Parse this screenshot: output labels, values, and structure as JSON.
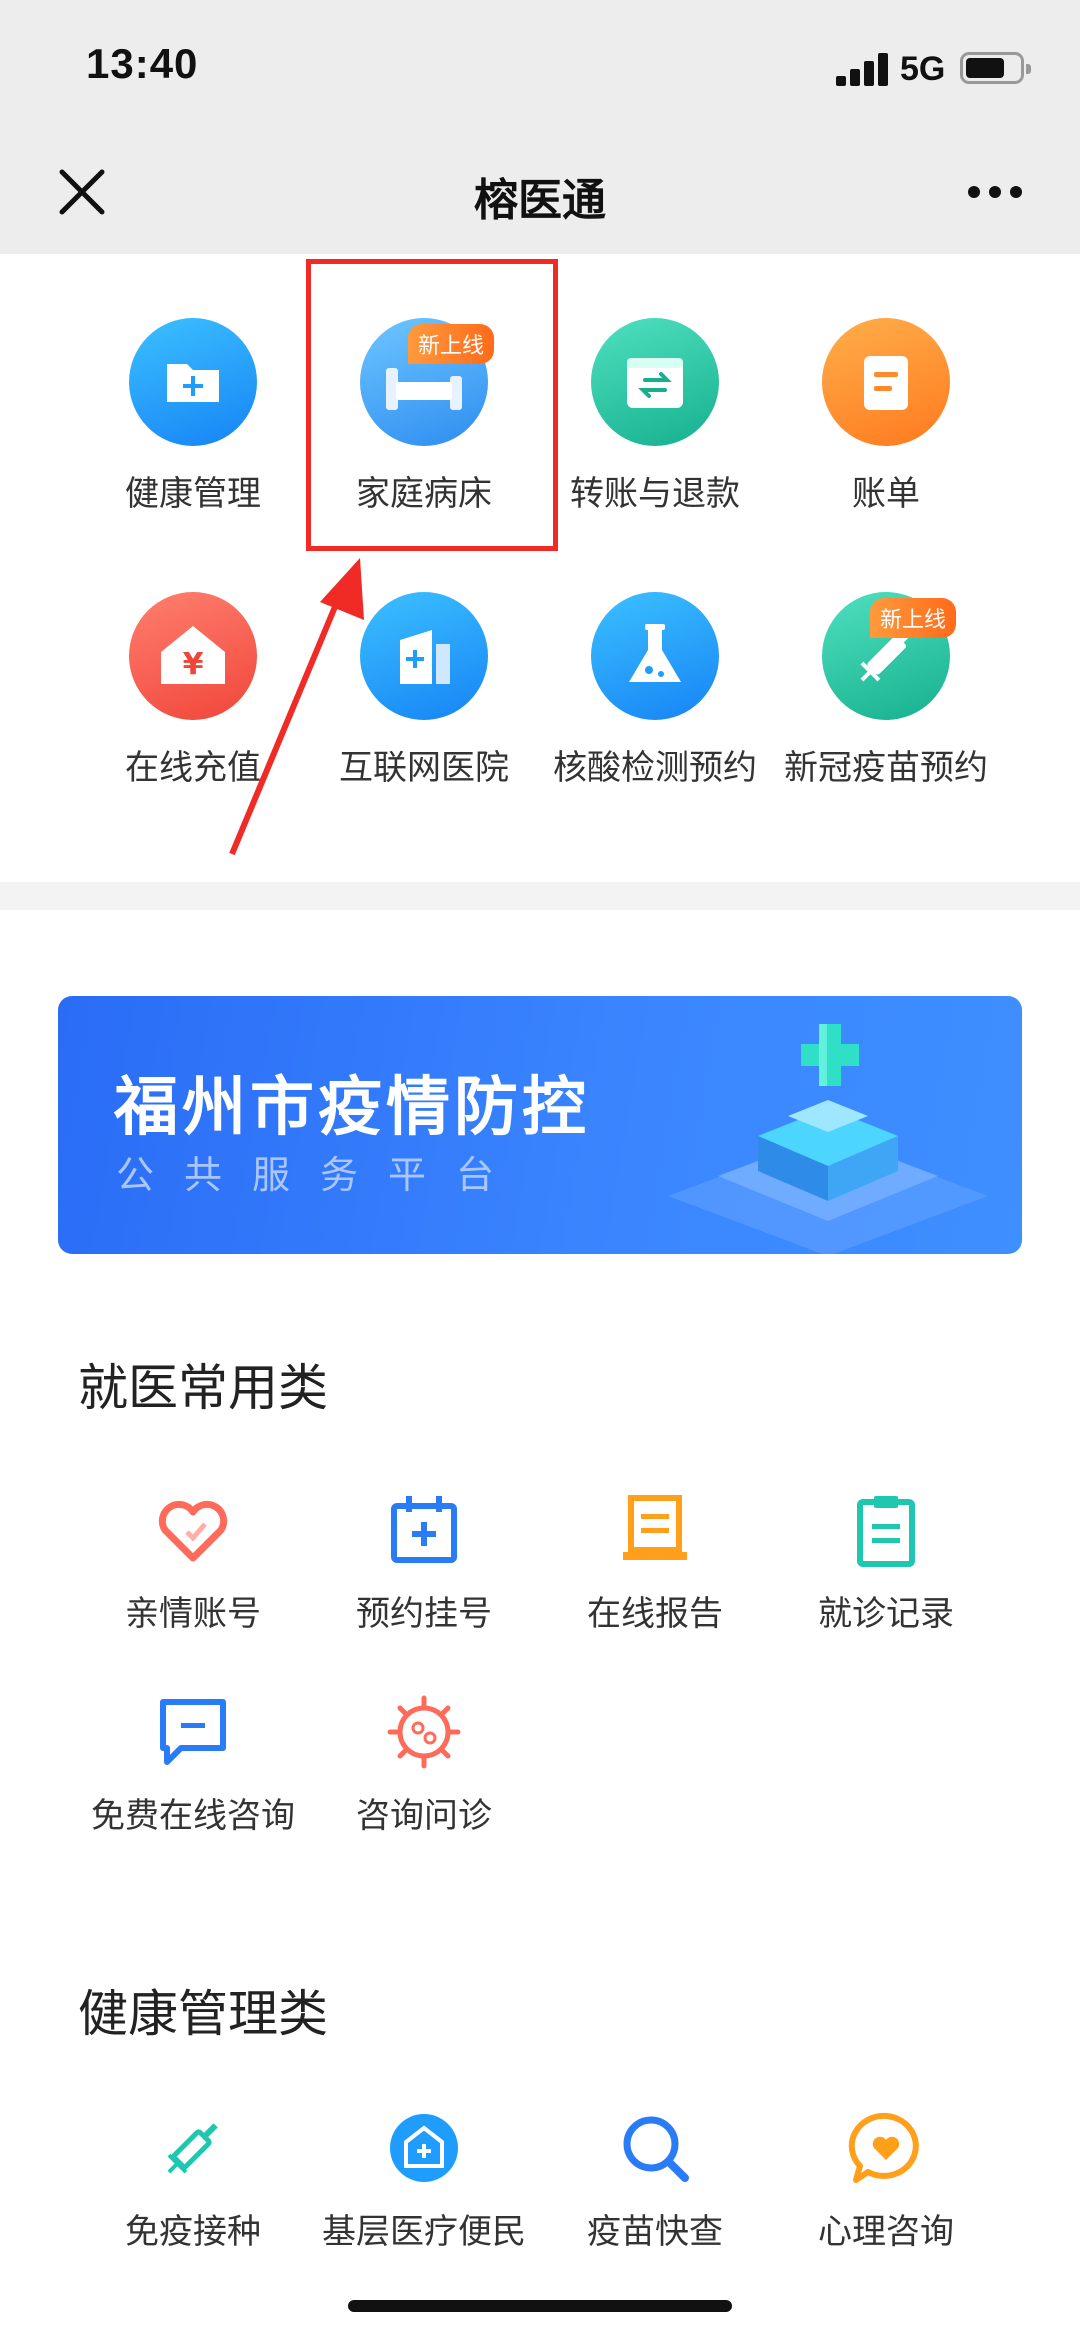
{
  "status_bar": {
    "time": "13:40",
    "network": "5G"
  },
  "title_bar": {
    "title": "榕医通"
  },
  "top_services": [
    {
      "label": "健康管理",
      "icon": "folder-plus-icon",
      "color": "#1e9dff"
    },
    {
      "label": "家庭病床",
      "icon": "bed-icon",
      "color": "#3aa6ff",
      "badge": "新上线"
    },
    {
      "label": "转账与退款",
      "icon": "transfer-icon",
      "color": "#22c4a2"
    },
    {
      "label": "账单",
      "icon": "bill-icon",
      "color": "#ff8a2c"
    },
    {
      "label": "在线充值",
      "icon": "recharge-icon",
      "color": "#ff5a4e"
    },
    {
      "label": "互联网医院",
      "icon": "hospital-icon",
      "color": "#1e9dff"
    },
    {
      "label": "核酸检测预约",
      "icon": "flask-icon",
      "color": "#1e9dff"
    },
    {
      "label": "新冠疫苗预约",
      "icon": "syringe-icon",
      "color": "#22c4a2",
      "badge": "新上线"
    }
  ],
  "banner": {
    "title": "福州市疫情防控",
    "subtitle": "公共服务平台"
  },
  "section_medical": {
    "title": "就医常用类",
    "items": [
      {
        "label": "亲情账号",
        "icon": "heart-icon",
        "color": "#ff6b5b"
      },
      {
        "label": "预约挂号",
        "icon": "calendar-plus-icon",
        "color": "#2a7bf6"
      },
      {
        "label": "在线报告",
        "icon": "report-icon",
        "color": "#ff9f1a"
      },
      {
        "label": "就诊记录",
        "icon": "clipboard-icon",
        "color": "#1fc7b0"
      },
      {
        "label": "免费在线咨询",
        "icon": "chat-icon",
        "color": "#2a7bf6"
      },
      {
        "label": "咨询问诊",
        "icon": "virus-icon",
        "color": "#ff6b5b"
      }
    ]
  },
  "section_health": {
    "title": "健康管理类",
    "items": [
      {
        "label": "免疫接种",
        "icon": "syringe-icon",
        "color": "#1fc7b0"
      },
      {
        "label": "基层医疗便民",
        "icon": "clinic-icon",
        "color": "#1e9dff"
      },
      {
        "label": "疫苗快查",
        "icon": "search-icon",
        "color": "#2a7bf6"
      },
      {
        "label": "心理咨询",
        "icon": "heart-chat-icon",
        "color": "#ff9f1a"
      }
    ]
  }
}
